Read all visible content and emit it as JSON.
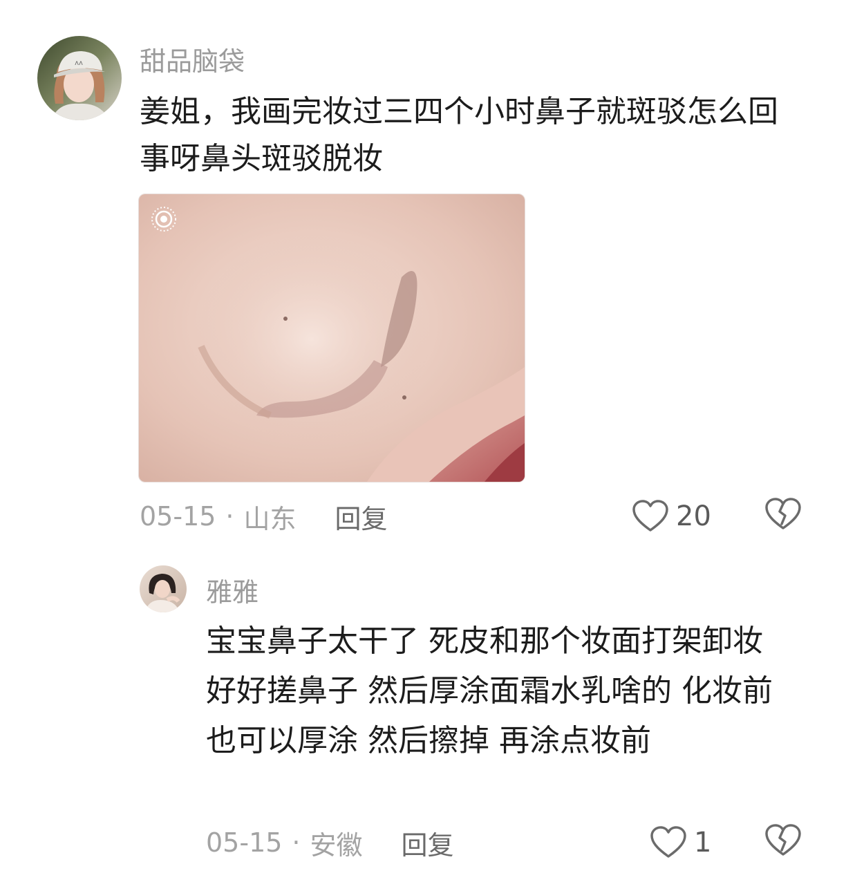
{
  "comments": [
    {
      "username": "甜品脑袋",
      "text": "姜姐，我画完妆过三四个小时鼻子就斑驳怎么回事呀鼻头斑驳脱妆",
      "date": "05-15",
      "separator": "·",
      "location": "山东",
      "reply_label": "回复",
      "like_count": "20",
      "has_image": true,
      "avatar_icon": "user-avatar-cap",
      "image_badge_icon": "live-photo-icon"
    },
    {
      "username": "雅雅",
      "text": "宝宝鼻子太干了 死皮和那个妆面打架卸妆 好好搓鼻子 然后厚涂面霜水乳啥的 化妆前也可以厚涂 然后擦掉 再涂点妆前",
      "date": "05-15",
      "separator": "·",
      "location": "安徽",
      "reply_label": "回复",
      "like_count": "1",
      "has_image": false,
      "avatar_icon": "user-avatar-girl"
    }
  ],
  "colors": {
    "username": "#9b9b9b",
    "body_text": "#1c1c1c",
    "meta_text": "#a3a3a3",
    "reply_text": "#6a6a6a",
    "icon_stroke": "#6b6b6b",
    "background": "#ffffff"
  }
}
